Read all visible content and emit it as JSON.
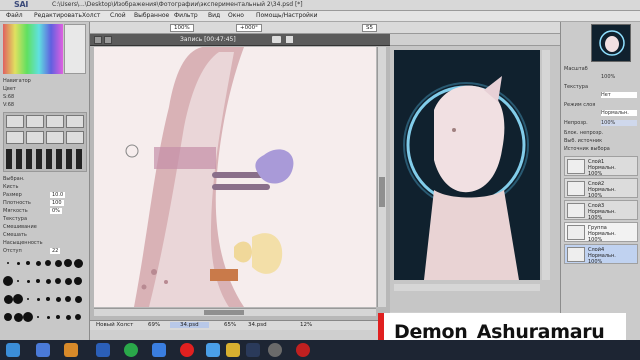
{
  "app": {
    "logo": "SAI",
    "window_title": "C:\\Users\\...\\Desktop\\Изображения\\Фотографии\\экспериментальный 2\\34.psd [*]"
  },
  "menu": [
    "Файл",
    "Редактировать",
    "Холст",
    "Слой",
    "Выбранное",
    "Фильтр",
    "Вид",
    "Окно",
    "Помощь/Настройки"
  ],
  "toolbar_fields": {
    "zoom": "100%",
    "angle": "+000°",
    "stabilizer": "S5"
  },
  "left_panel": {
    "rows": [
      "Навигатор",
      "Цвет",
      "S:68",
      "V:68",
      "Выбран.",
      "Кисть",
      "Размер",
      "Плотность",
      "Мягкость",
      "Текстура",
      "Смешивание",
      "Смешать",
      "Насыщенность",
      "Отступ",
      "Мин. размер",
      "Мин. плот."
    ],
    "values": {
      "size": "10.0",
      "density": "100",
      "min_size": "0%",
      "spacing": "22"
    }
  },
  "canvas": {
    "title": "Запись [00:47:45]"
  },
  "status_bar": {
    "items": [
      "Новый Холст",
      "69%",
      "34.psd",
      "65%",
      "34.psd",
      "12%"
    ]
  },
  "layers_panel": {
    "labels": [
      "Масштаб",
      "100%",
      "Текстура",
      "Нет",
      "Режим слоя",
      "Нормальн.",
      "Непрозр.",
      "100%",
      "Блок. непрозр.",
      "Выб. источник",
      "Источник выбора"
    ],
    "items": [
      {
        "name": "Слой1",
        "mode": "Нормальн.",
        "opacity": "100%"
      },
      {
        "name": "Слой2",
        "mode": "Нормальн.",
        "opacity": "100%"
      },
      {
        "name": "Слой3",
        "mode": "Нормальн.",
        "opacity": "100%"
      },
      {
        "name": "Группа",
        "mode": "Нормальн.",
        "opacity": "100%"
      },
      {
        "name": "Слой4",
        "mode": "Нормальн.",
        "opacity": "100%"
      }
    ]
  },
  "taskbar": {
    "icons": [
      "start-icon",
      "folder-icon",
      "media-icon",
      "word-icon",
      "chrome-icon",
      "edge-icon",
      "yandex-icon",
      "app-icon",
      "folder2-icon",
      "steam-icon",
      "settings-icon",
      "record-icon"
    ]
  },
  "watermark": {
    "text": "Demon_Ashuramaru"
  }
}
